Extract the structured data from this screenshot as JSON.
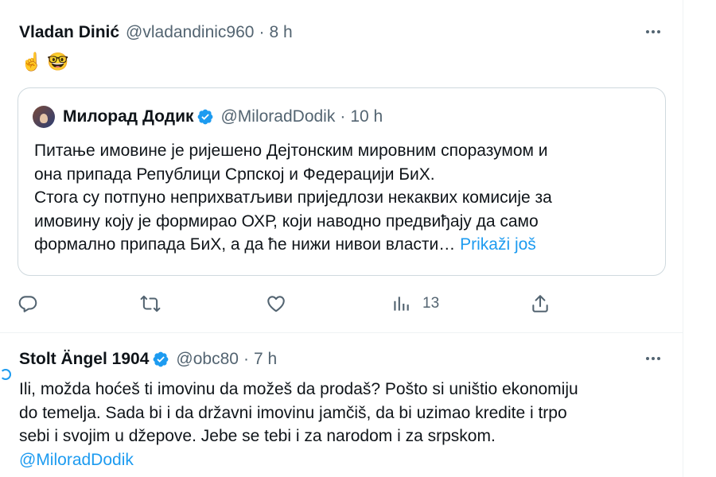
{
  "tweet1": {
    "name": "Vladan Dinić",
    "handle": "@vladandinic960",
    "separator": "·",
    "time": "8 h",
    "emojis": [
      "☝️",
      "🤓"
    ],
    "quote": {
      "name": "Милорад Додик",
      "handle": "@MiloradDodik",
      "separator": "·",
      "time": "10 h",
      "lines": [
        "Питање имовине је ријешено Дејтонским мировним споразумом и",
        "она припада Републици Српској и Федерацији БиХ.",
        "Стога су потпуно неприхватљиви приједлози некаквих комисије за",
        "имовину коју је формирао ОХР, који наводно предвиђају да само"
      ],
      "last_line": "формално припада БиХ, а да ће нижи нивои власти…",
      "show_more": "Prikaži još"
    },
    "actions": {
      "views_count": "13"
    }
  },
  "tweet2": {
    "name": "Stolt Ängel 1904",
    "handle": "@obc80",
    "separator": "·",
    "time": "7 h",
    "lines": [
      "Ili, možda hoćeš ti imovinu da možeš da prodaš? Pošto si uništio ekonomiju",
      "do temelja. Sada bi i da državni imovinu jamčiš, da bi uzimao kredite i trpo",
      "sebi i svojim u džepove. Jebe se tebi i za narodom i za srpskom."
    ],
    "mention": "@MiloradDodik"
  },
  "colors": {
    "accent": "#1d9bf0",
    "text": "#0f1419",
    "secondary": "#536471",
    "border": "#cfd9de"
  },
  "icons": {
    "reply": "reply-icon",
    "retweet": "retweet-icon",
    "like": "like-icon",
    "views": "views-icon",
    "share": "share-icon",
    "verified": "verified-badge-icon",
    "more": "more-icon"
  }
}
